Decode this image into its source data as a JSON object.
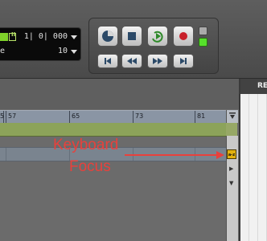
{
  "counter": {
    "main": "1| 0| 000",
    "sub": "10",
    "edge_char": "e",
    "chip_label": "II"
  },
  "ruler": {
    "labels": [
      "57",
      "65",
      "73",
      "81"
    ],
    "left_partial": "5"
  },
  "annotation": {
    "line1": "Keyboard",
    "line2": "Focus",
    "color": "#e8413c"
  },
  "keyboard_focus_button": {
    "label": "a-z",
    "color": "#e2b10e"
  },
  "right_panel": {
    "title": "RE"
  },
  "transport": {
    "top_buttons": [
      "online-icon",
      "stop-icon",
      "loop-play-icon",
      "record-icon"
    ],
    "bottom_buttons": [
      "return-to-zero-icon",
      "rewind-icon",
      "fast-forward-icon",
      "go-to-end-icon"
    ],
    "status_leds": [
      "grey",
      "green"
    ]
  }
}
